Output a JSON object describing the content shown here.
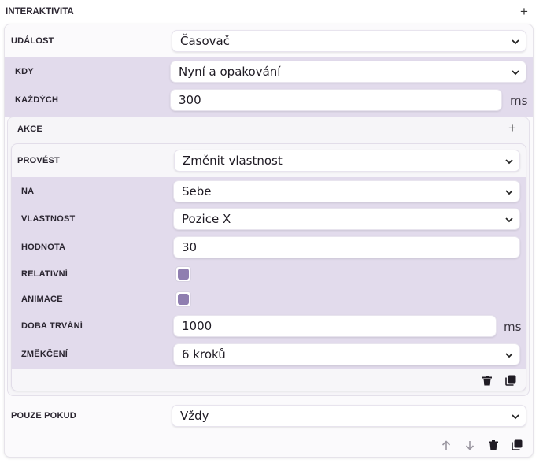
{
  "header": {
    "title": "INTERAKTIVITA"
  },
  "event": {
    "label": "UDÁLOST",
    "value": "Časovač"
  },
  "when": {
    "label": "KDY",
    "value": "Nyní a opakování"
  },
  "every": {
    "label": "KAŽDÝCH",
    "value": "300",
    "unit": "ms"
  },
  "actions": {
    "label": "AKCE",
    "perform": {
      "label": "PROVÉST",
      "value": "Změnit vlastnost"
    },
    "target": {
      "label": "NA",
      "value": "Sebe"
    },
    "property": {
      "label": "VLASTNOST",
      "value": "Pozice X"
    },
    "value": {
      "label": "HODNOTA",
      "value": "30"
    },
    "relative": {
      "label": "RELATIVNÍ",
      "checked": true
    },
    "animate": {
      "label": "ANIMACE",
      "checked": true
    },
    "duration": {
      "label": "DOBA TRVÁNÍ",
      "value": "1000",
      "unit": "ms"
    },
    "easing": {
      "label": "ZMĚKČENÍ",
      "value": "6 kroků"
    }
  },
  "only_if": {
    "label": "POUZE POKUD",
    "value": "Vždy"
  },
  "icons": {
    "add": "plus-icon",
    "delete": "trash-icon",
    "duplicate": "duplicate-icon",
    "move_up": "arrow-up-icon",
    "move_down": "arrow-down-icon",
    "dropdown": "chevron-down-icon"
  },
  "colors": {
    "accent": "#8f7eb0",
    "band": "#e2dbec"
  }
}
